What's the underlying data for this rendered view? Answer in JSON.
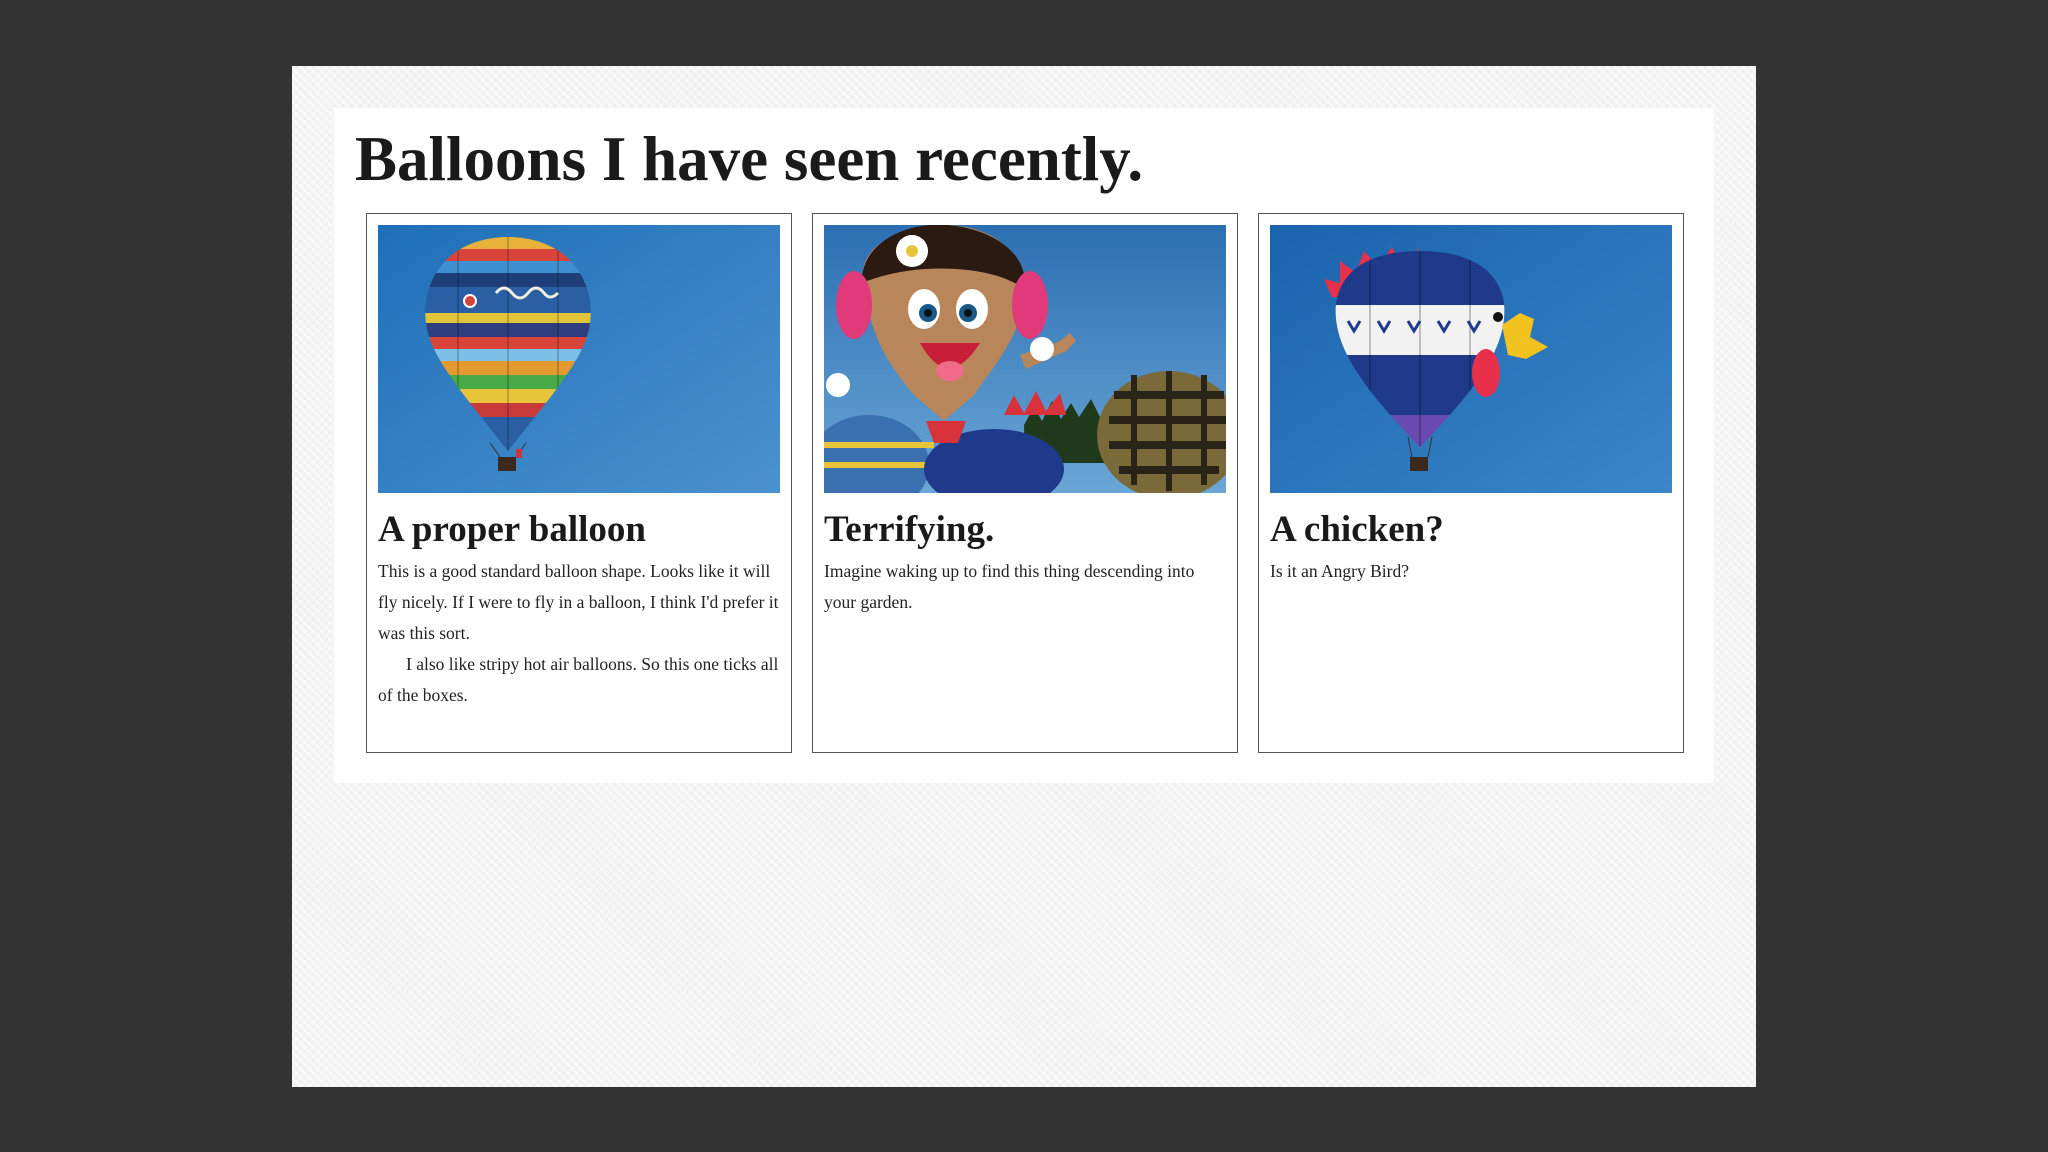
{
  "page": {
    "title": "Balloons I have seen recently."
  },
  "cards": [
    {
      "image": "balloon-photo",
      "heading": "A proper balloon",
      "paragraphs": [
        "This is a good standard balloon shape. Looks like it will fly nicely. If I were to fly in a balloon, I think I'd prefer it was this sort.",
        "I also like stripy hot air balloons. So this one ticks all of the boxes."
      ]
    },
    {
      "image": "balloon-photo",
      "heading": "Terrifying.",
      "paragraphs": [
        "Imagine waking up to find this thing descending into your garden."
      ]
    },
    {
      "image": "balloon-photo",
      "heading": "A chicken?",
      "paragraphs": [
        "Is it an Angry Bird?"
      ]
    }
  ],
  "colors": {
    "backdrop": "#333333",
    "viewport_background": "#f4f4f4",
    "page_background": "#ffffff",
    "card_border": "#555555",
    "text": "#1a1a1a",
    "sky": "#2f7fc0"
  }
}
